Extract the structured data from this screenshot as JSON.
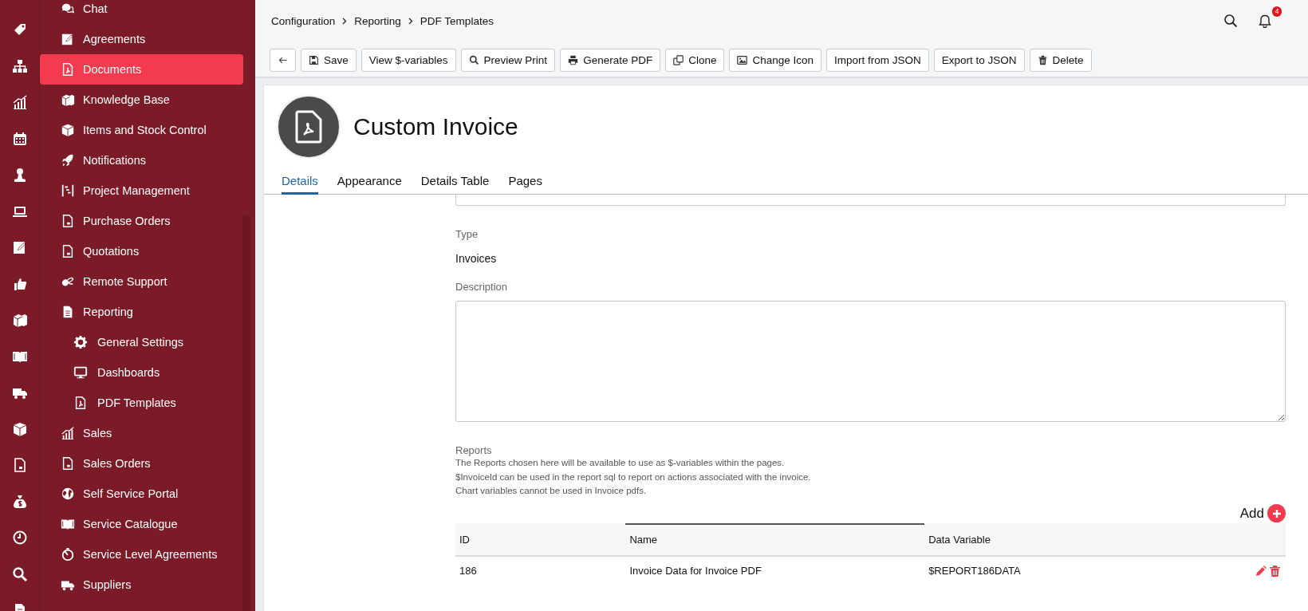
{
  "sidebar": {
    "items": [
      {
        "label": "Chat",
        "selected": false
      },
      {
        "label": "Agreements",
        "selected": false
      },
      {
        "label": "Documents",
        "selected": true
      },
      {
        "label": "Knowledge Base",
        "selected": false
      },
      {
        "label": "Items and Stock Control",
        "selected": false
      },
      {
        "label": "Notifications",
        "selected": false
      },
      {
        "label": "Project Management",
        "selected": false
      },
      {
        "label": "Purchase Orders",
        "selected": false
      },
      {
        "label": "Quotations",
        "selected": false
      },
      {
        "label": "Remote Support",
        "selected": false
      },
      {
        "label": "Reporting",
        "selected": false,
        "children": [
          {
            "label": "General Settings",
            "selected": false
          },
          {
            "label": "Dashboards",
            "selected": false
          },
          {
            "label": "PDF Templates",
            "selected": false
          }
        ]
      },
      {
        "label": "Sales",
        "selected": false
      },
      {
        "label": "Sales Orders",
        "selected": false
      },
      {
        "label": "Self Service Portal",
        "selected": false
      },
      {
        "label": "Service Catalogue",
        "selected": false
      },
      {
        "label": "Service Level Agreements",
        "selected": false
      },
      {
        "label": "Suppliers",
        "selected": false
      }
    ]
  },
  "breadcrumb": [
    "Configuration",
    "Reporting",
    "PDF Templates"
  ],
  "notifications": {
    "count": "4"
  },
  "toolbar": [
    {
      "kind": "back"
    },
    {
      "kind": "save",
      "label": "Save"
    },
    {
      "kind": "plain",
      "label": "View $-variables"
    },
    {
      "kind": "search",
      "label": "Preview Print"
    },
    {
      "kind": "print",
      "label": "Generate PDF"
    },
    {
      "kind": "clone",
      "label": "Clone"
    },
    {
      "kind": "image",
      "label": "Change Icon"
    },
    {
      "kind": "plain",
      "label": "Import from JSON"
    },
    {
      "kind": "plain",
      "label": "Export to JSON"
    },
    {
      "kind": "delete",
      "label": "Delete"
    }
  ],
  "record": {
    "title": "Custom Invoice",
    "tabs": [
      {
        "label": "Details",
        "selected": true
      },
      {
        "label": "Appearance",
        "selected": false
      },
      {
        "label": "Details Table",
        "selected": false
      },
      {
        "label": "Pages",
        "selected": false
      }
    ],
    "type": {
      "label": "Type",
      "value": "Invoices"
    },
    "description": {
      "label": "Description"
    },
    "reports": {
      "label": "Reports",
      "help": [
        "The Reports chosen here will be available to use as $-variables within the pages.",
        "$InvoiceId can be used in the report sql to report on actions associated with the invoice.",
        "Chart variables cannot be used in Invoice pdfs."
      ],
      "add": "Add",
      "columns": [
        {
          "label": "ID",
          "sorted": false
        },
        {
          "label": "Name",
          "sorted": true
        },
        {
          "label": "Data Variable",
          "sorted": false
        }
      ],
      "rows": [
        {
          "cells": [
            "186",
            "Invoice Data for Invoice PDF",
            "$REPORT186DATA"
          ]
        }
      ]
    }
  }
}
